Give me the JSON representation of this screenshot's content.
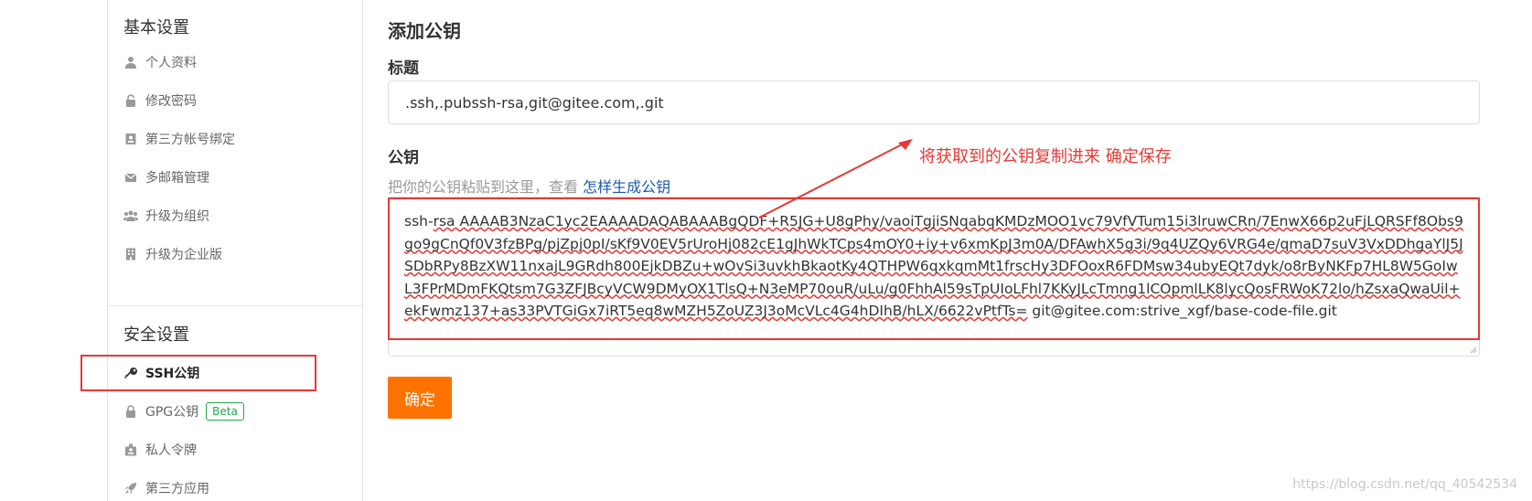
{
  "sidebar": {
    "basic_section": "基本设置",
    "basic_items": [
      {
        "label": "个人资料",
        "icon": "user-icon"
      },
      {
        "label": "修改密码",
        "icon": "unlock-icon"
      },
      {
        "label": "第三方帐号绑定",
        "icon": "contact-card-icon"
      },
      {
        "label": "多邮箱管理",
        "icon": "envelope-icon"
      },
      {
        "label": "升级为组织",
        "icon": "users-icon"
      },
      {
        "label": "升级为企业版",
        "icon": "building-icon"
      }
    ],
    "security_section": "安全设置",
    "security_items": [
      {
        "label": "SSH公钥",
        "icon": "key-icon",
        "active": true
      },
      {
        "label": "GPG公钥",
        "icon": "lock-icon",
        "badge": "Beta"
      },
      {
        "label": "私人令牌",
        "icon": "badge-icon"
      },
      {
        "label": "第三方应用",
        "icon": "rocket-icon"
      }
    ]
  },
  "form": {
    "heading": "添加公钥",
    "title_label": "标题",
    "title_value": ".ssh,.pubssh-rsa,git@gitee.com,.git",
    "key_label": "公钥",
    "hint_text": "把你的公钥粘贴到这里，查看",
    "hint_link": "怎样生成公钥",
    "key_prefix": "ssh-",
    "key_body": "rsa AAAAB3NzaC1yc2EAAAADAQABAAABgQDF+R5JG+U8gPhy/vaoiTgjiSNqabqKMDzMOO1vc79VfVTum15i3lruwCRn/7EnwX66p2uFjLQRSFf8Obs9go9gCnQf0V3fzBPg/pjZpj0pI/sKf9V0EV5rUroHj082cE1gJhWkTCps4mOY0+iy+v6xmKpJ3m0A/DFAwhX5g3i/9q4UZQy6VRG4e/qmaD7suV3VxDDhgaYlJ5JSDbRPy8BzXW11nxajL9GRdh800EjkDBZu+wOvSi3uvkhBkaotKy4QTHPW6qxkqmMt1frscHy3DFOoxR6FDMsw34ubyEQt7dyk/o8rByNKFp7HL8W5GoIwL3FPrMDmFKQtsm7G3ZFJBcyVCW9DMyOX1TlsQ+N3eMP70ouR/uLu/g0FhhAl59sTpUIoLFhl7KKyJLcTmng1lCOpmlLK8lycQosFRWoK72lo/hZsxaQwaUil+ekFwmz137+as33PVTGiGx7iRT5eq8wMZH5ZoUZ3J3oMcVLc4G4hDIhB/hLX/6622vPtfTs=",
    "key_suffix": " git@gitee.com:strive_xgf/base-code-file.git",
    "confirm_label": "确定"
  },
  "annotation": {
    "text": "将获取到的公钥复制进来 确定保存",
    "color": "#e53935"
  },
  "watermark": "https://blog.csdn.net/qq_40542534",
  "colors": {
    "accent": "#fe7300",
    "highlight": "#e53935",
    "link": "#1a5aa8",
    "badge": "#22a74a"
  }
}
